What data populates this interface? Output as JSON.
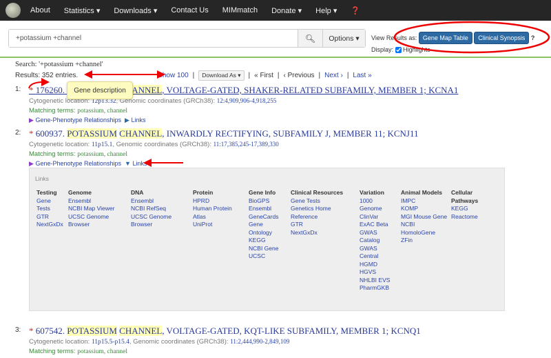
{
  "nav": {
    "items": [
      "About",
      "Statistics ▾",
      "Downloads ▾",
      "Contact Us",
      "MIMmatch",
      "Donate ▾",
      "Help ▾"
    ],
    "help_icon": "question-circle-icon"
  },
  "search": {
    "value": "+potassium +channel",
    "options_label": "Options ▾"
  },
  "view": {
    "label": "View Results as:",
    "gene_map": "Gene Map Table",
    "clinical": "Clinical Synopsis",
    "display_label": "Display:",
    "highlights": "Highlights",
    "highlights_checked": true
  },
  "summary": {
    "search": "Search: '+potassium +channel'",
    "results": "Results: 352 entries.",
    "show": "Show 100",
    "download": "Download As ▾",
    "first": "« First",
    "previous": "‹ Previous",
    "next": "Next ›",
    "last": "Last »"
  },
  "tooltip": "Gene description",
  "entries": [
    {
      "num": "1:",
      "id": "176260.",
      "pre": "",
      "h1": "POTASSIUM",
      "h2": "CHANNEL",
      "rest": ", VOLTAGE-GATED, SHAKER-RELATED SUBFAMILY, MEMBER 1; KCNA1",
      "cyto": "12p13.32",
      "coords": "12:4,909,906-4,918,255",
      "terms": "potassium, channel"
    },
    {
      "num": "2:",
      "id": "600937.",
      "h1": "POTASSIUM",
      "h2": "CHANNEL",
      "rest": ", INWARDLY RECTIFYING, SUBFAMILY J, MEMBER 11; KCNJ11",
      "cyto": "11p15.1",
      "coords": "11:17,385,245-17,389,330",
      "terms": "potassium, channel"
    },
    {
      "num": "3:",
      "id": "607542.",
      "h1": "POTASSIUM",
      "h2": "CHANNEL",
      "rest": ", VOLTAGE-GATED, KQT-LIKE SUBFAMILY, MEMBER 1; KCNQ1",
      "cyto": "11p15.5-p15.4",
      "coords": "11:2,444,990-2,849,109",
      "terms": "potassium, channel"
    }
  ],
  "labels": {
    "cyto": "Cytogenetic location: ",
    "coords": ", Genomic coordinates (GRCh38): ",
    "matching": "Matching terms: ",
    "gpr": "Gene-Phenotype Relationships",
    "links": "Links"
  },
  "links_panel": {
    "title": "Links",
    "columns": [
      {
        "head": "Testing",
        "items": [
          "Gene",
          "Tests",
          "GTR",
          "NextGxDx"
        ]
      },
      {
        "head": "Genome",
        "items": [
          "Ensembl",
          "NCBI Map Viewer",
          "UCSC Genome",
          "Browser"
        ]
      },
      {
        "head": "DNA",
        "items": [
          "Ensembl",
          "NCBI RefSeq",
          "UCSC Genome",
          "Browser"
        ]
      },
      {
        "head": "Protein",
        "items": [
          "HPRD",
          "Human Protein",
          "Atlas",
          "UniProt"
        ]
      },
      {
        "head": "Gene Info",
        "items": [
          "BioGPS",
          "Ensembl",
          "GeneCards",
          "Gene",
          "Ontology",
          "KEGG",
          "NCBI Gene",
          "UCSC"
        ]
      },
      {
        "head": "Clinical Resources",
        "items": [
          "Gene Tests",
          "Genetics Home",
          "Reference",
          "GTR",
          "NextGxDx"
        ]
      },
      {
        "head": "Variation",
        "items": [
          "1000",
          "Genome",
          "ClinVar",
          "ExAC Beta",
          "GWAS",
          "Catalog",
          "GWAS",
          "Central",
          "HGMD",
          "HGVS",
          "NHLBI EVS",
          "PharmGKB"
        ]
      },
      {
        "head": "Animal Models",
        "items": [
          "IMPC",
          "KOMP",
          "MGI Mouse Gene",
          "NCBI",
          "HomoloGene",
          "ZFin"
        ]
      },
      {
        "head": "Cellular Pathways",
        "items": [
          "KEGG",
          "Reactome"
        ]
      }
    ]
  },
  "colors": {
    "nav": "#262626",
    "button": "#2d6aa3",
    "link": "#2a44a8",
    "match": "#3a8a3a",
    "highlight": "#ffffb8",
    "annotation": "#e00000"
  }
}
